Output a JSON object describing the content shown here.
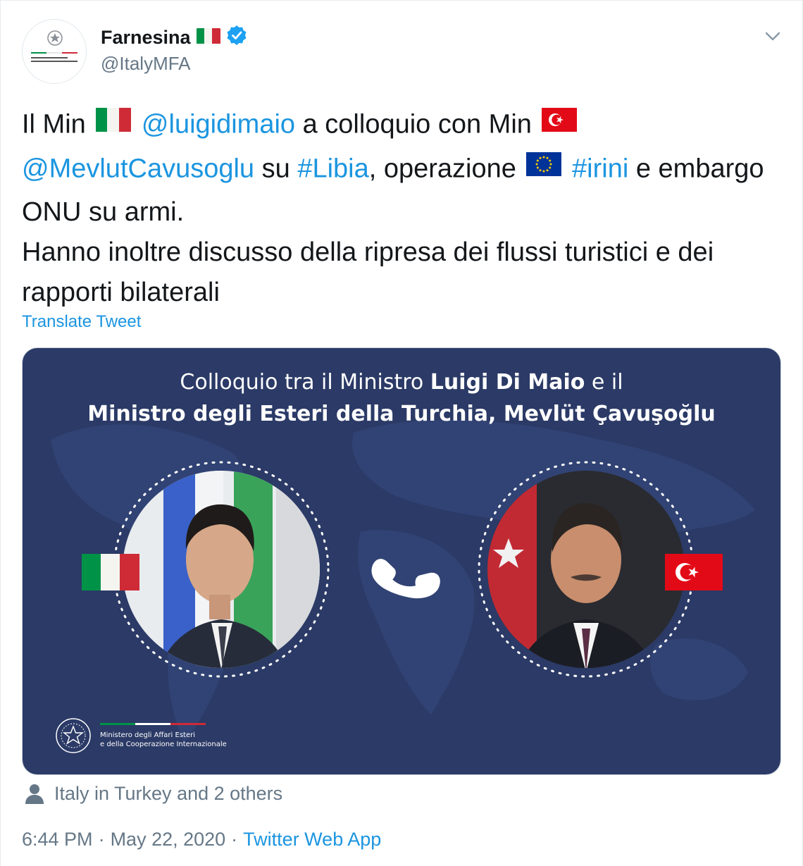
{
  "account": {
    "display_name": "Farnesina",
    "handle": "@ItalyMFA",
    "avatar_caption": "Ministero degli Affari Esteri e della Cooperazione Internazionale"
  },
  "tweet": {
    "t1": "Il Min",
    "m1": "@luigidimaio",
    "t2": "a colloquio con Min",
    "m2": "@MevlutCavusoglu",
    "t3": "su",
    "h1": "#Libia",
    "t4": ", operazione",
    "h2": "#irini",
    "t5": "e embargo ONU su armi.",
    "t6": "Hanno inoltre discusso della ripresa dei flussi turistici e dei rapporti bilaterali"
  },
  "translate_label": "Translate Tweet",
  "media": {
    "title_line1_a": "Colloquio tra il Ministro ",
    "title_line1_b": "Luigi Di Maio",
    "title_line1_c": " e il",
    "title_line2": "Ministro degli Esteri della Turchia, Mevlüt Çavuşoğlu",
    "ministry_line1": "Ministero degli Affari Esteri",
    "ministry_line2": "e della Cooperazione Internazionale"
  },
  "tagged_text": "Italy in Turkey and 2 others",
  "meta": {
    "time": "6:44 PM",
    "separator1": "·",
    "date": "May 22, 2020",
    "separator2": "·",
    "source": "Twitter Web App"
  },
  "colors": {
    "link": "#1b95e0",
    "secondary_text": "#657786",
    "verified": "#1da1f2",
    "media_background": "#2b3a66",
    "italy_green": "#009246",
    "italy_red": "#ce2b37",
    "turkey_red": "#e30a17",
    "eu_blue": "#003399"
  },
  "icons": [
    "italy-flag-icon",
    "verified-badge-icon",
    "chevron-down-icon",
    "turkey-flag-icon",
    "eu-flag-icon",
    "phone-icon",
    "person-icon",
    "emblem-icon"
  ]
}
